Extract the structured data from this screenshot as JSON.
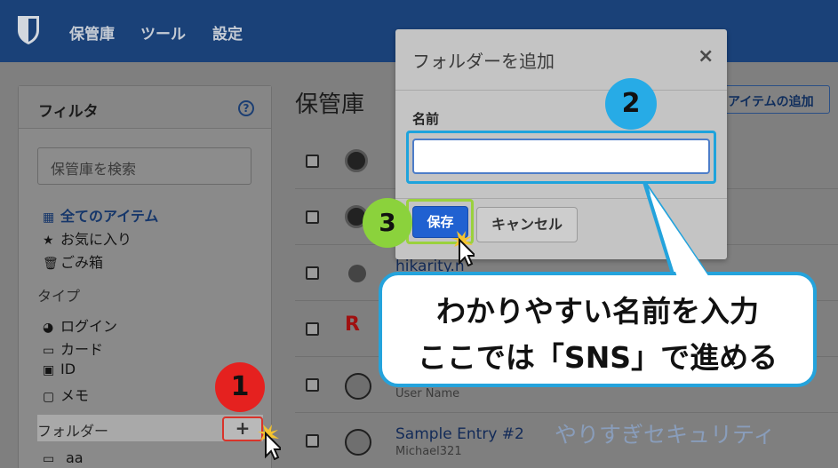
{
  "nav": {
    "items": [
      "保管庫",
      "ツール",
      "設定"
    ]
  },
  "filter": {
    "title": "フィルタ",
    "help": "?",
    "search_placeholder": "保管庫を検索",
    "items": [
      {
        "icon": "▦",
        "label": "全てのアイテム"
      },
      {
        "icon": "★",
        "label": "お気に入り"
      },
      {
        "icon": "🗑",
        "label": "ごみ箱"
      }
    ],
    "types_heading": "タイプ",
    "types": [
      {
        "icon": "◕",
        "label": "ログイン"
      },
      {
        "icon": "▭",
        "label": "カード"
      },
      {
        "icon": "▣",
        "label": "ID"
      },
      {
        "icon": "▢",
        "label": "メモ"
      }
    ],
    "folders_heading": "フォルダー",
    "add_folder": "+",
    "folders": [
      {
        "icon": "▭",
        "label": "aa"
      }
    ]
  },
  "vault": {
    "title": "保管庫",
    "add_item": "アイテムの追加",
    "rows": [
      {
        "name": "",
        "sub": ""
      },
      {
        "name": "",
        "sub": ""
      },
      {
        "name": "hikarity.n",
        "sub": ""
      },
      {
        "name": "",
        "sub": ""
      },
      {
        "name": "",
        "sub": "User Name"
      },
      {
        "name": "Sample Entry #2",
        "sub": "Michael321"
      }
    ]
  },
  "modal": {
    "title": "フォルダーを追加",
    "close": "×",
    "name_label": "名前",
    "name_value": "",
    "save": "保存",
    "cancel": "キャンセル"
  },
  "annotations": {
    "marker1": "1",
    "marker2": "2",
    "marker3": "3",
    "callout_line1": "わかりやすい名前を入力",
    "callout_line2": "ここでは「SNS」で進める",
    "watermark": "やりすぎセキュリティ"
  },
  "colors": {
    "nav_bg": "#1a4178",
    "save_btn": "#2061d1",
    "marker1": "#e5211f",
    "marker2": "#27abe6",
    "marker3": "#8bd23c",
    "callout_border": "#24a3dc"
  }
}
